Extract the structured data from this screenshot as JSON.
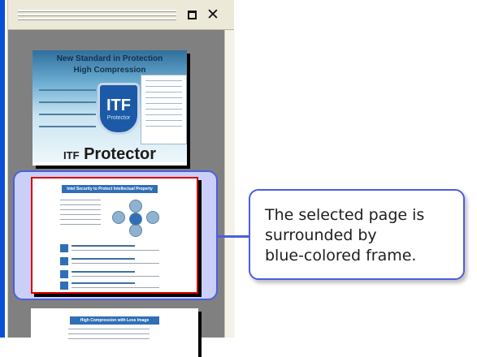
{
  "panel": {
    "restore_icon": "restore-window-icon",
    "close_icon": "close-icon",
    "close_glyph": "✕"
  },
  "pages": [
    {
      "heading_line1": "New Standard in Protection",
      "heading_line2": "High Compression",
      "emblem_text": "ITF",
      "emblem_subtext": "Protector",
      "brand_prefix": "ITF",
      "brand_name": "Protector"
    },
    {
      "heading": "Intel Security to Protect Intellectual Property"
    },
    {
      "heading": "High Compression with Less Image Degradation"
    }
  ],
  "callout": {
    "text_line1": "The selected page is",
    "text_line2": "surrounded by",
    "text_line3": "blue-colored frame."
  },
  "colors": {
    "selection_frame": "#4b5ee0",
    "selection_fill": "#c9cff7",
    "page_border": "#d40000",
    "panel_bg": "#ece9d8",
    "view_bg": "#808080"
  }
}
